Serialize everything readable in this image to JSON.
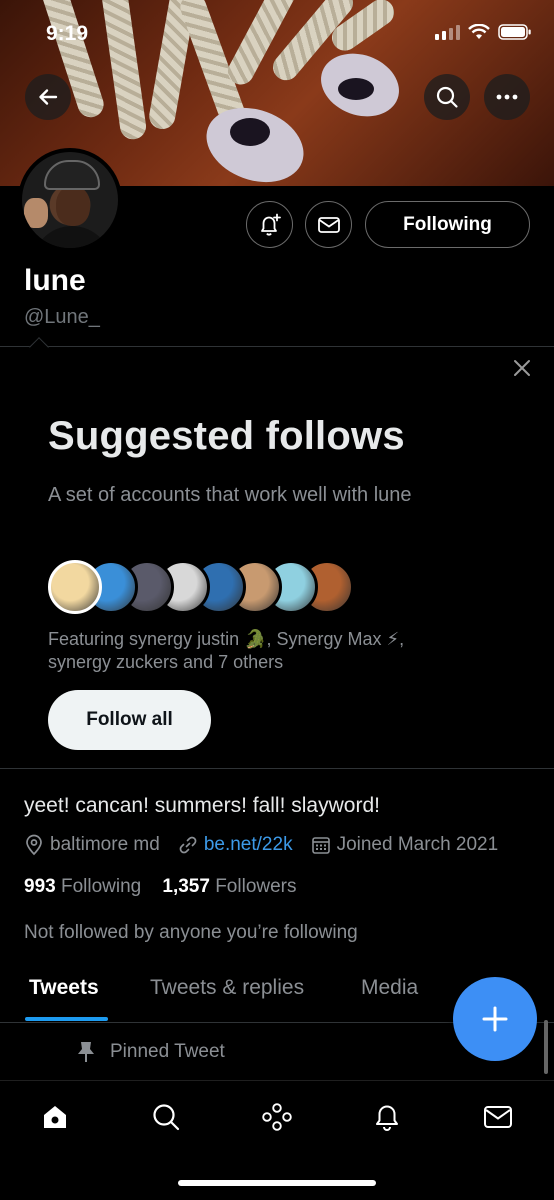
{
  "status_bar": {
    "time": "9:19"
  },
  "profile": {
    "display_name": "lune",
    "handle": "@Lune_",
    "following_button": "Following",
    "bio": "yeet! cancan! summers! fall! slayword!",
    "location": "baltimore md",
    "website": "be.net/22k",
    "joined": "Joined March 2021",
    "following_count": "993",
    "following_label": "Following",
    "followers_count": "1,357",
    "followers_label": "Followers",
    "not_followed_text": "Not followed by anyone you’re following"
  },
  "suggested": {
    "title": "Suggested follows",
    "subtitle": "A set of accounts that work well with lune",
    "featuring_line1": "Featuring synergy justin 🐊, Synergy Max ⚡,",
    "featuring_line2": "synergy zuckers and 7 others",
    "follow_all_label": "Follow all",
    "avatar_colors": [
      "#f2d8a0",
      "#3a8fd8",
      "#5a5a6a",
      "#d8d8d8",
      "#2f6fb0",
      "#c89a70",
      "#8fd0e0",
      "#b06030"
    ]
  },
  "tabs": [
    {
      "label": "Tweets",
      "active": true
    },
    {
      "label": "Tweets & replies",
      "active": false
    },
    {
      "label": "Media",
      "active": false
    }
  ],
  "pinned_label": "Pinned Tweet",
  "colors": {
    "accent": "#1d9bf0",
    "fab": "#3d8ff5",
    "background": "#000000",
    "muted_text": "#8b8f94"
  },
  "icons": {
    "back": "arrow-left-icon",
    "search": "search-icon",
    "more": "more-horizontal-icon",
    "notify": "bell-plus-icon",
    "message": "envelope-icon",
    "close": "close-icon",
    "location": "location-pin-icon",
    "link": "link-icon",
    "calendar": "calendar-icon",
    "compose": "plus-icon",
    "pin": "pin-icon",
    "nav": [
      "home-icon",
      "search-icon",
      "spaces-icon",
      "bell-icon",
      "mail-icon"
    ]
  }
}
